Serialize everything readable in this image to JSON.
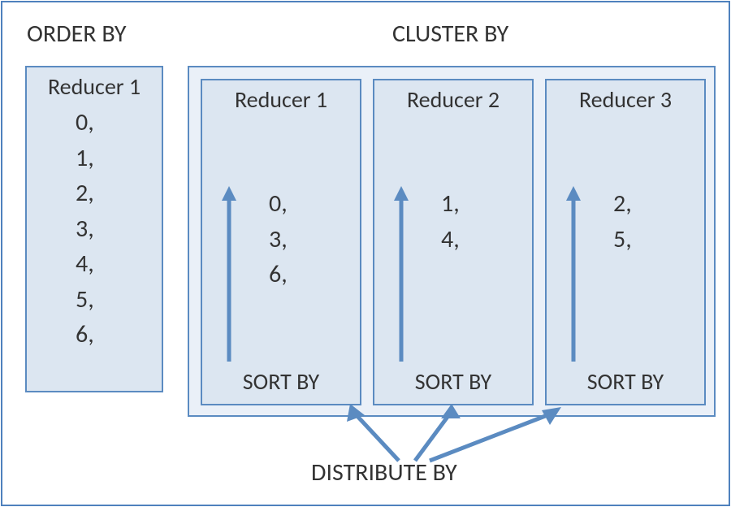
{
  "titles": {
    "orderby": "ORDER BY",
    "clusterby": "CLUSTER BY",
    "distribute": "DISTRIBUTE BY",
    "sortby": "SORT BY"
  },
  "orderby_box": {
    "title": "Reducer 1",
    "values": [
      "0,",
      "1,",
      "2,",
      "3,",
      "4,",
      "5,",
      "6,"
    ]
  },
  "cluster": {
    "reducers": [
      {
        "title": "Reducer 1",
        "values": [
          "0,",
          "3,",
          "6,"
        ]
      },
      {
        "title": "Reducer 2",
        "values": [
          "1,",
          "4,"
        ]
      },
      {
        "title": "Reducer 3",
        "values": [
          "2,",
          "5,"
        ]
      }
    ]
  }
}
